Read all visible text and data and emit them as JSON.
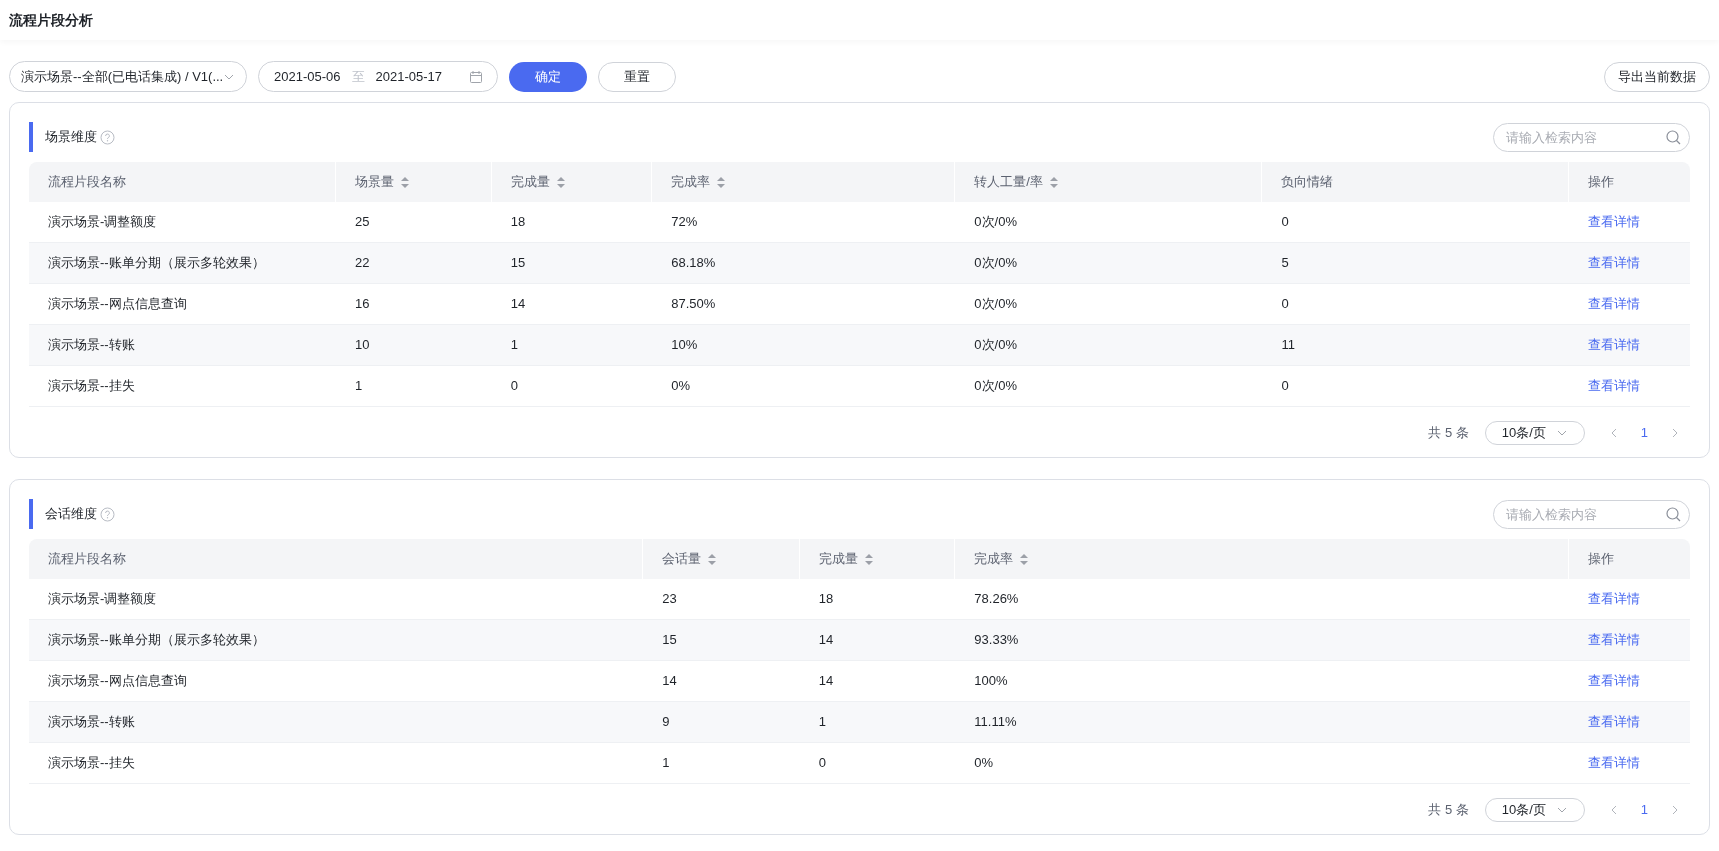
{
  "page_title": "流程片段分析",
  "toolbar": {
    "scene_select": "演示场景--全部(已电话集成) / V1(...",
    "date_start": "2021-05-06",
    "date_sep": "至",
    "date_end": "2021-05-17",
    "confirm": "确定",
    "reset": "重置",
    "export": "导出当前数据"
  },
  "panels": [
    {
      "title": "场景维度",
      "search": {
        "placeholder": "请输入检索内容"
      },
      "columns": [
        {
          "label": "流程片段名称",
          "sortable": false
        },
        {
          "label": "场景量",
          "sortable": true
        },
        {
          "label": "完成量",
          "sortable": true
        },
        {
          "label": "完成率",
          "sortable": true
        },
        {
          "label": "转人工量/率",
          "sortable": true
        },
        {
          "label": "负向情绪",
          "sortable": false
        },
        {
          "label": "操作",
          "sortable": false
        }
      ],
      "rows": [
        {
          "cells": [
            "演示场景-调整额度",
            "25",
            "18",
            "72%",
            "0次/0%",
            "0"
          ],
          "action": "查看详情"
        },
        {
          "cells": [
            "演示场景--账单分期（展示多轮效果）",
            "22",
            "15",
            "68.18%",
            "0次/0%",
            "5"
          ],
          "action": "查看详情"
        },
        {
          "cells": [
            "演示场景--网点信息查询",
            "16",
            "14",
            "87.50%",
            "0次/0%",
            "0"
          ],
          "action": "查看详情"
        },
        {
          "cells": [
            "演示场景--转账",
            "10",
            "1",
            "10%",
            "0次/0%",
            "11"
          ],
          "action": "查看详情"
        },
        {
          "cells": [
            "演示场景--挂失",
            "1",
            "0",
            "0%",
            "0次/0%",
            "0"
          ],
          "action": "查看详情"
        }
      ],
      "pagination": {
        "total": "共 5 条",
        "page_size": "10条/页",
        "pages": [
          {
            "label": "1",
            "selected": true
          }
        ]
      }
    },
    {
      "title": "会话维度",
      "search": {
        "placeholder": "请输入检索内容"
      },
      "columns": [
        {
          "label": "流程片段名称",
          "sortable": false
        },
        {
          "label": "会话量",
          "sortable": true
        },
        {
          "label": "完成量",
          "sortable": true
        },
        {
          "label": "完成率",
          "sortable": true
        },
        {
          "label": "操作",
          "sortable": false
        }
      ],
      "rows": [
        {
          "cells": [
            "演示场景-调整额度",
            "23",
            "18",
            "78.26%"
          ],
          "action": "查看详情"
        },
        {
          "cells": [
            "演示场景--账单分期（展示多轮效果）",
            "15",
            "14",
            "93.33%"
          ],
          "action": "查看详情"
        },
        {
          "cells": [
            "演示场景--网点信息查询",
            "14",
            "14",
            "100%"
          ],
          "action": "查看详情"
        },
        {
          "cells": [
            "演示场景--转账",
            "9",
            "1",
            "11.11%"
          ],
          "action": "查看详情"
        },
        {
          "cells": [
            "演示场景--挂失",
            "1",
            "0",
            "0%"
          ],
          "action": "查看详情"
        }
      ],
      "pagination": {
        "total": "共 5 条",
        "page_size": "10条/页",
        "pages": [
          {
            "label": "1",
            "selected": true
          }
        ]
      }
    }
  ]
}
